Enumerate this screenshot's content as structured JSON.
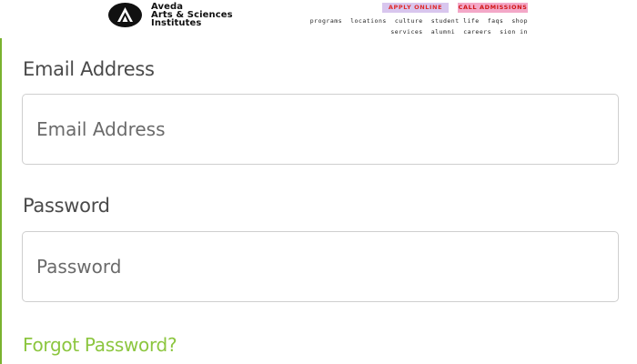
{
  "header": {
    "logo": {
      "icon": "aveda-triangle-logo",
      "line1": "Aveda",
      "line2": "Arts & Sciences",
      "line3": "Institutes"
    },
    "apply_online": "APPLY ONLINE",
    "call_admissions": "CALL ADMISSIONS",
    "nav_primary": [
      "programs",
      "locations",
      "culture",
      "student life",
      "faqs",
      "shop"
    ],
    "nav_secondary": [
      "services",
      "alumni",
      "careers",
      "sign in"
    ]
  },
  "form": {
    "email": {
      "label": "Email Address",
      "placeholder": "Email Address",
      "value": ""
    },
    "password": {
      "label": "Password",
      "placeholder": "Password",
      "value": ""
    },
    "forgot_password": "Forgot Password?"
  },
  "colors": {
    "accent_green": "#8cc63f",
    "apply_bg": "#d8c6ee",
    "call_bg": "#f3a8c8",
    "cta_text": "#e02a2a"
  }
}
